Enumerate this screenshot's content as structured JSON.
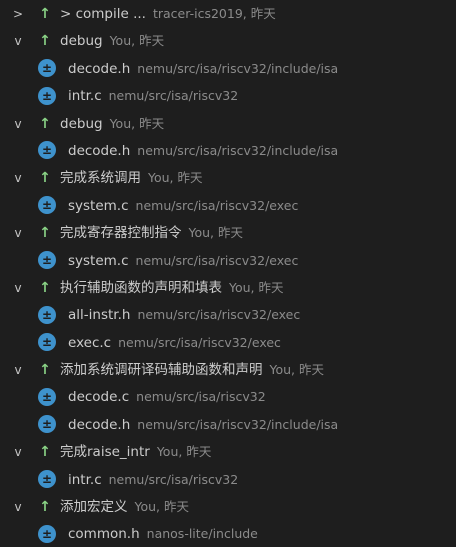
{
  "icons": {
    "arrow": "↑",
    "badge": "±",
    "chevron_collapsed": ">",
    "chevron_expanded": "v"
  },
  "colors": {
    "arrow": "#89d185",
    "badge": "#3e92cc",
    "meta_text": "#8b8b8b",
    "background": "#1e1e1e"
  },
  "commits": [
    {
      "title": "> compile ...",
      "meta": "tracer-ics2019, 昨天",
      "expanded": false,
      "files": []
    },
    {
      "title": "debug",
      "meta": "You, 昨天",
      "expanded": true,
      "files": [
        {
          "name": "decode.h",
          "path": "nemu/src/isa/riscv32/include/isa"
        },
        {
          "name": "intr.c",
          "path": "nemu/src/isa/riscv32"
        }
      ]
    },
    {
      "title": "debug",
      "meta": "You, 昨天",
      "expanded": true,
      "files": [
        {
          "name": "decode.h",
          "path": "nemu/src/isa/riscv32/include/isa"
        }
      ]
    },
    {
      "title": "完成系统调用",
      "meta": "You, 昨天",
      "expanded": true,
      "files": [
        {
          "name": "system.c",
          "path": "nemu/src/isa/riscv32/exec"
        }
      ]
    },
    {
      "title": "完成寄存器控制指令",
      "meta": "You, 昨天",
      "expanded": true,
      "files": [
        {
          "name": "system.c",
          "path": "nemu/src/isa/riscv32/exec"
        }
      ]
    },
    {
      "title": "执行辅助函数的声明和填表",
      "meta": "You, 昨天",
      "expanded": true,
      "files": [
        {
          "name": "all-instr.h",
          "path": "nemu/src/isa/riscv32/exec"
        },
        {
          "name": "exec.c",
          "path": "nemu/src/isa/riscv32/exec"
        }
      ]
    },
    {
      "title": "添加系统调研译码辅助函数和声明",
      "meta": "You, 昨天",
      "expanded": true,
      "files": [
        {
          "name": "decode.c",
          "path": "nemu/src/isa/riscv32"
        },
        {
          "name": "decode.h",
          "path": "nemu/src/isa/riscv32/include/isa"
        }
      ]
    },
    {
      "title": "完成raise_intr",
      "meta": "You, 昨天",
      "expanded": true,
      "files": [
        {
          "name": "intr.c",
          "path": "nemu/src/isa/riscv32"
        }
      ]
    },
    {
      "title": "添加宏定义",
      "meta": "You, 昨天",
      "expanded": true,
      "files": [
        {
          "name": "common.h",
          "path": "nanos-lite/include"
        }
      ]
    }
  ]
}
